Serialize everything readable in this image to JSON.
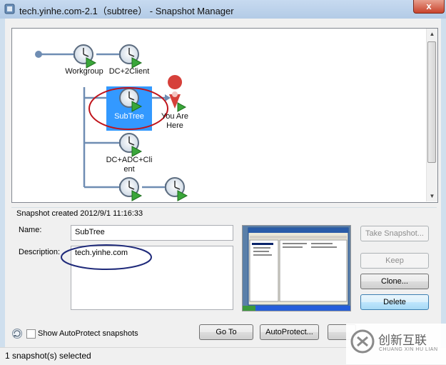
{
  "window": {
    "title": "tech.yinhe.com-2.1（subtree） - Snapshot Manager",
    "close_label": "x"
  },
  "tree": {
    "nodes": [
      {
        "label": "Workgroup"
      },
      {
        "label": "DC+2Client"
      },
      {
        "label": "SubTree",
        "selected": true
      },
      {
        "label_line1": "DC+ADC+Cli",
        "label_line2": "ent"
      }
    ],
    "you_are_here_line1": "You Are",
    "you_are_here_line2": "Here"
  },
  "details": {
    "created": "Snapshot created 2012/9/1 11:16:33",
    "name_label": "Name:",
    "name_value": "SubTree",
    "description_label": "Description:",
    "description_value": "tech.yinhe.com"
  },
  "actions": {
    "take_snapshot": "Take Snapshot...",
    "keep": "Keep",
    "clone": "Clone...",
    "delete": "Delete"
  },
  "bottom": {
    "show_autoprotect": "Show AutoProtect snapshots",
    "go_to": "Go To",
    "autoprotect": "AutoProtect..."
  },
  "status": {
    "text": "1 snapshot(s) selected"
  },
  "watermark": {
    "main": "创新互联",
    "sub": "CHUANG XIN HU LIAN"
  },
  "colors": {
    "selection": "#3399ff",
    "annotation_red": "#c0141b",
    "annotation_navy": "#1f2a7a",
    "tree_line": "#6f8db3"
  }
}
